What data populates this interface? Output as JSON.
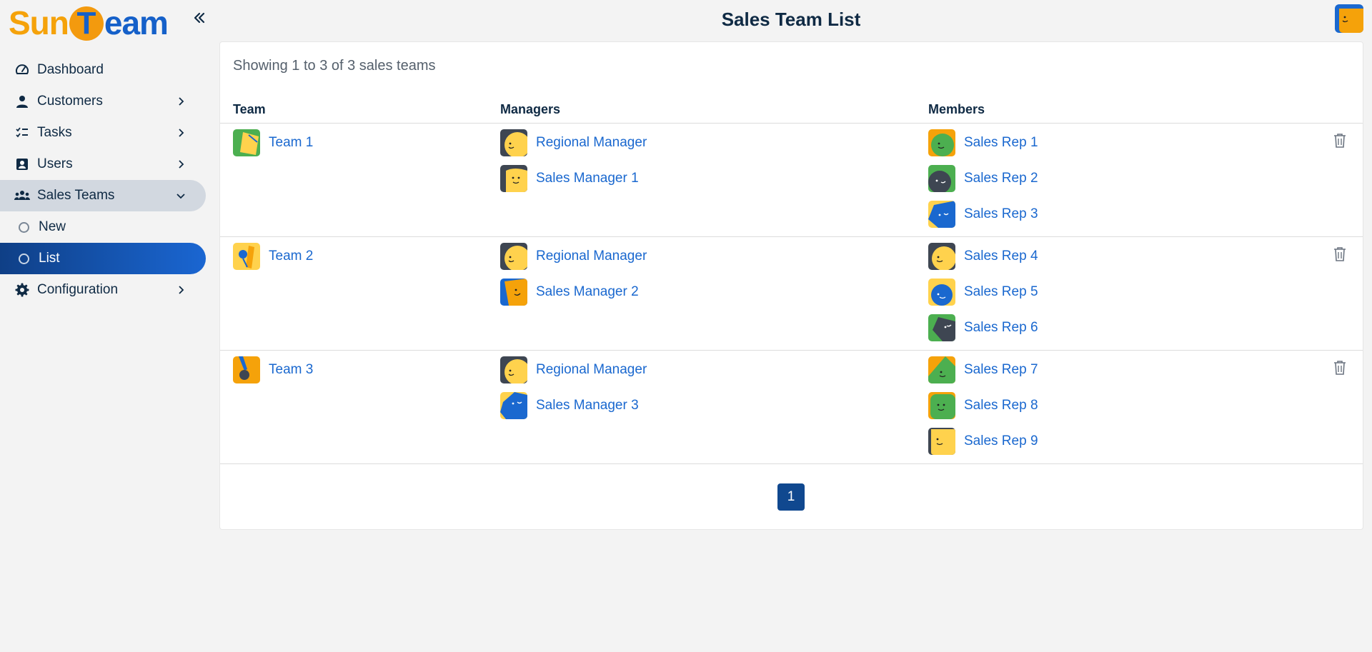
{
  "app": {
    "logo_text": "SunTeam",
    "page_title": "Sales Team List"
  },
  "sidebar": {
    "items": [
      {
        "label": "Dashboard"
      },
      {
        "label": "Customers"
      },
      {
        "label": "Tasks"
      },
      {
        "label": "Users"
      },
      {
        "label": "Sales Teams"
      },
      {
        "label": "New"
      },
      {
        "label": "List"
      },
      {
        "label": "Configuration"
      }
    ]
  },
  "table": {
    "summary": "Showing 1 to 3 of 3 sales teams",
    "headers": {
      "team": "Team",
      "managers": "Managers",
      "members": "Members"
    },
    "rows": [
      {
        "team": "Team 1",
        "managers": [
          "Regional Manager",
          "Sales Manager 1"
        ],
        "members": [
          "Sales Rep 1",
          "Sales Rep 2",
          "Sales Rep 3"
        ]
      },
      {
        "team": "Team 2",
        "managers": [
          "Regional Manager",
          "Sales Manager 2"
        ],
        "members": [
          "Sales Rep 4",
          "Sales Rep 5",
          "Sales Rep 6"
        ]
      },
      {
        "team": "Team 3",
        "managers": [
          "Regional Manager",
          "Sales Manager 3"
        ],
        "members": [
          "Sales Rep 7",
          "Sales Rep 8",
          "Sales Rep 9"
        ]
      }
    ]
  },
  "pagination": {
    "current_page": "1"
  },
  "colors": {
    "link": "#1a68cf",
    "active_nav_start": "#0f3f86",
    "active_nav_end": "#1a66d2",
    "expanded_nav": "#d2d8e0",
    "pager": "#10488f",
    "logo_orange": "#f5a20a",
    "logo_blue": "#1560c9"
  }
}
